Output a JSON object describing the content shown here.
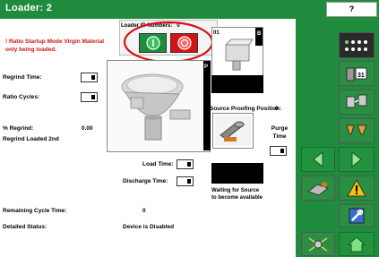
{
  "header": {
    "title": "Loader:  2",
    "help_label": "?"
  },
  "loader_id": {
    "label": "Loader ID Numbers:",
    "value": "0"
  },
  "status_text": "! Ratio Startup Mode Virgin Material only being loaded.",
  "fields": {
    "regrind_time": "Regrind Time:",
    "ratio_cycles": "Ratio Cycles:",
    "pct_regrind_label": "% Regrind:",
    "pct_regrind_value": "0.00",
    "regrind_loaded": "Regrind Loaded 2nd",
    "load_time": "Load Time:",
    "discharge_time": "Discharge Time:",
    "remaining_cycle_label": "Remaining Cycle Time:",
    "remaining_cycle_value": "0",
    "detailed_status_label": "Detailed Status:",
    "detailed_status_value": "Device is Disabled"
  },
  "valve_panel": {
    "badge": "01",
    "letter": "B"
  },
  "loader_image": {
    "letter": "P"
  },
  "source_proofing": {
    "label": "Source Proofing Position:",
    "value": "0"
  },
  "purge": {
    "line1": "Purge",
    "line2": "Time"
  },
  "waiting_text": {
    "line1": "Waiting for Source",
    "line2": "to become available"
  },
  "icons": {
    "start": "start-icon",
    "stop": "stop-icon",
    "dots": "dots-menu-icon",
    "loader": "loader-icon",
    "calendar": "calendar-icon",
    "receivers": "receivers-icon",
    "hoppers": "hoppers-icon",
    "left": "arrow-left-icon",
    "right": "arrow-right-icon",
    "source": "source-icon",
    "alarm": "alarm-icon",
    "tools": "tools-icon",
    "network": "network-icon",
    "home": "home-icon"
  },
  "colors": {
    "header": "#1e8c3c",
    "accent_red": "#d41414",
    "alarm": "#f4c20d"
  }
}
